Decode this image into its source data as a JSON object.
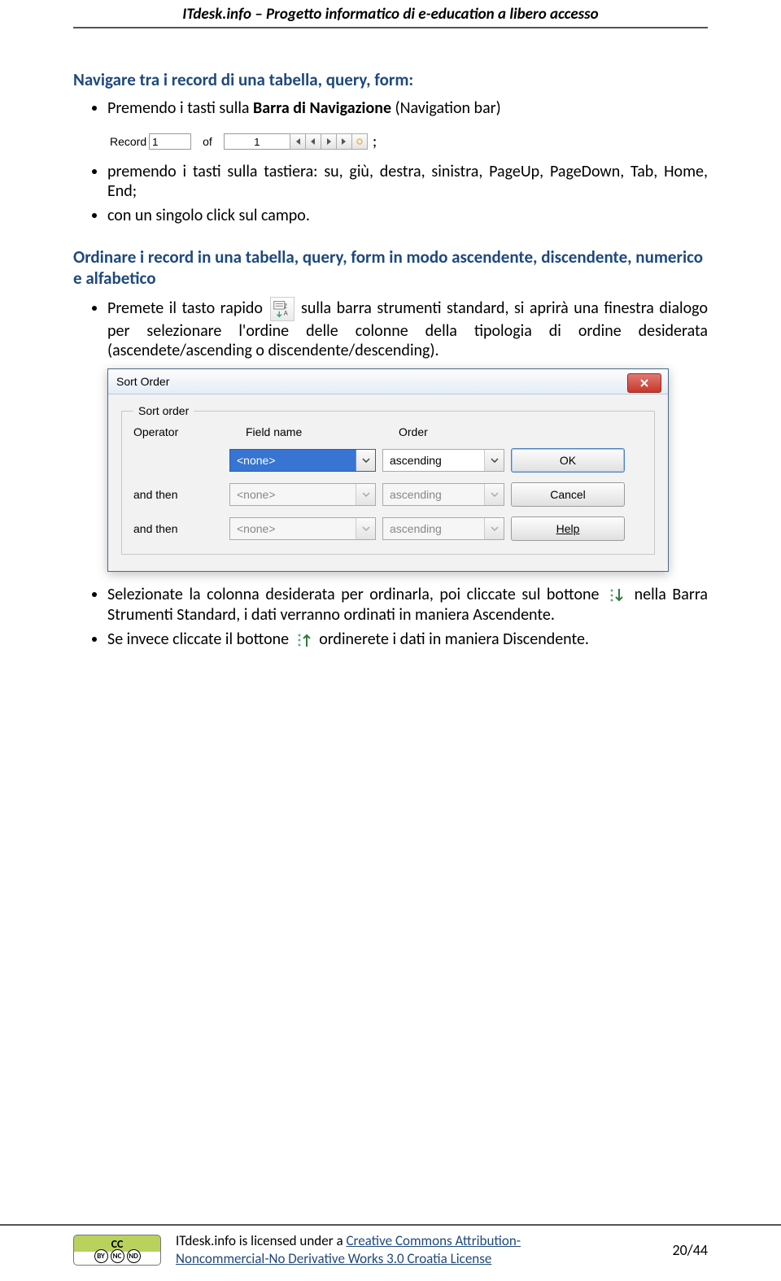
{
  "header": {
    "title": "ITdesk.info – Progetto informatico di e-education a libero accesso"
  },
  "section1": {
    "heading": "Navigare tra i record di una tabella, query, form:",
    "bullet1_a": "Premendo i tasti sulla ",
    "bullet1_b": "Barra di Navigazione",
    "bullet1_c": " (Navigation bar)",
    "nav": {
      "record_label": "Record",
      "record_value": "1",
      "of_label": "of",
      "total": "1"
    },
    "bullet1_end": ";",
    "bullet2": "premendo i tasti sulla tastiera: su, giù, destra, sinistra, PageUp, PageDown, Tab, Home, End;",
    "bullet3": "con un singolo click sul campo."
  },
  "section2": {
    "heading": "Ordinare i record in una tabella, query, form in modo ascendente, discendente, numerico e alfabetico",
    "bullet1": "Premete il tasto rapido  sulla barra strumenti standard, si aprirà una finestra dialogo per selezionare l'ordine delle colonne della tipologia di ordine desiderata (ascendete/ascending o discendente/descending)."
  },
  "dialog": {
    "title": "Sort Order",
    "legend": "Sort order",
    "headers": {
      "operator": "Operator",
      "field": "Field name",
      "order": "Order"
    },
    "rows": [
      {
        "op": "",
        "field": "<none>",
        "order": "ascending",
        "selected": true,
        "disabled": false
      },
      {
        "op": "and then",
        "field": "<none>",
        "order": "ascending",
        "selected": false,
        "disabled": true
      },
      {
        "op": "and then",
        "field": "<none>",
        "order": "ascending",
        "selected": false,
        "disabled": true
      }
    ],
    "buttons": {
      "ok": "OK",
      "cancel": "Cancel",
      "help": "Help"
    }
  },
  "section3": {
    "bullet1_a": "Selezionate la colonna desiderata per ordinarla, poi cliccate sul bottone ",
    "bullet1_b": " nella Barra Strumenti Standard, i dati verranno ordinati in maniera Ascendente.",
    "bullet2_a": "Se invece cliccate il bottone ",
    "bullet2_b": " ordinerete i dati in maniera Discendente."
  },
  "footer": {
    "text_a": "ITdesk.info is licensed under a ",
    "link1": "Creative Commons Attribution-",
    "link2": "Noncommercial-No Derivative Works 3.0 Croatia License",
    "page": "20/44",
    "cc": {
      "label": "CC",
      "c1": "BY",
      "c2": "NC",
      "c3": "ND"
    }
  }
}
